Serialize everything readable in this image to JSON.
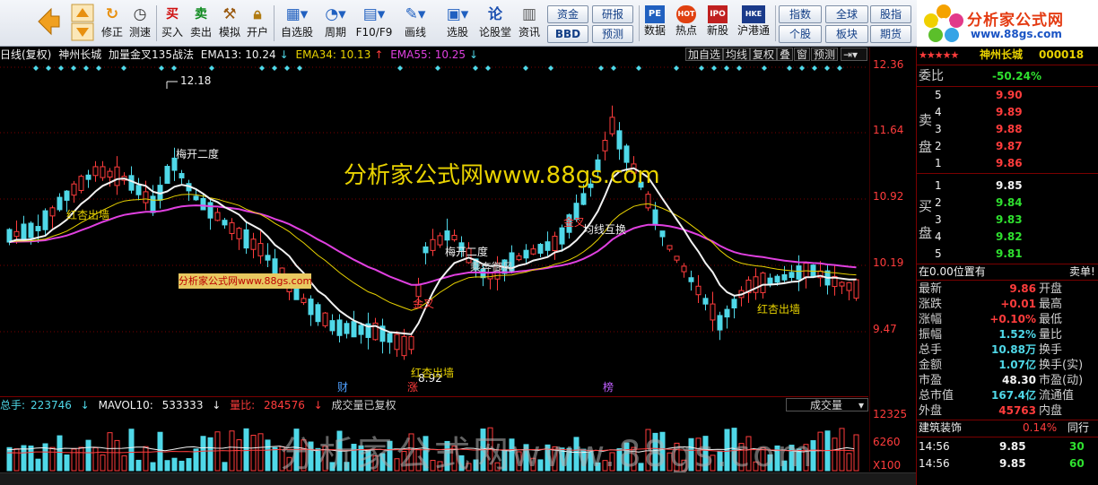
{
  "toolbar": {
    "buttons": [
      {
        "label": "修正"
      },
      {
        "label": "测速"
      },
      {
        "label": "买入"
      },
      {
        "label": "卖出"
      },
      {
        "label": "模拟"
      },
      {
        "label": "开户"
      },
      {
        "label": "自选股"
      },
      {
        "label": "周期"
      },
      {
        "label": "F10/F9"
      },
      {
        "label": "画线"
      },
      {
        "label": "选股"
      },
      {
        "label": "论股堂"
      },
      {
        "label": "资讯"
      },
      {
        "label": "数据"
      },
      {
        "label": "热点"
      },
      {
        "label": "新股"
      },
      {
        "label": "沪港通"
      }
    ],
    "icon_buy": "买",
    "icon_sell": "卖",
    "icon_lun": "论",
    "icon_pe": "PE",
    "icon_hot": "HOT",
    "icon_ipo": "IPO",
    "icon_hk": "HKE",
    "box_buttons": [
      "资金",
      "研报",
      "BBD",
      "预测",
      "指数",
      "全球",
      "股指",
      "个股",
      "板块",
      "期货"
    ]
  },
  "logo": {
    "name": "分析家公式网",
    "url": "www.88gs.com"
  },
  "chart_header": {
    "period": "日线(复权)",
    "stock_name": "神州长城",
    "indicator_name": "加量金叉135战法",
    "ema13_label": "EMA13:",
    "ema13": "10.24",
    "ema34_label": "EMA34:",
    "ema34": "10.13",
    "ema55_label": "EMA55:",
    "ema55": "10.25",
    "buttons": [
      "加自选",
      "均线",
      "复权",
      "叠",
      "窗",
      "预测"
    ]
  },
  "watermark_main": "分析家公式网www.88gs.com",
  "promo_box": "分析家公式网www.88gs.com",
  "annotations": {
    "high_value": "12.18",
    "low_value": "8.92",
    "labels": [
      {
        "text": "红杏出墙",
        "color": "#e8d200"
      },
      {
        "text": "梅开二度",
        "color": "#f2f2f2"
      },
      {
        "text": "红杏出墙",
        "color": "#e8d200"
      },
      {
        "text": "金叉",
        "color": "#ff3c3c"
      },
      {
        "text": "梅开二度",
        "color": "#f2f2f2"
      },
      {
        "text": "乘奔御风",
        "color": "#cfcfcf"
      },
      {
        "text": "金叉",
        "color": "#ff3c3c"
      },
      {
        "text": "均线互换",
        "color": "#f2f2f2"
      },
      {
        "text": "红杏出墙",
        "color": "#e8d200"
      }
    ],
    "markers": [
      {
        "text": "财",
        "color": "#4fa0ff"
      },
      {
        "text": "涨",
        "color": "#ff3c3c"
      },
      {
        "text": "榜",
        "color": "#c060ff"
      }
    ]
  },
  "volume_header": {
    "total_label": "总手:",
    "total": "223746",
    "mavol_label": "MAVOL10:",
    "mavol": "533333",
    "ratio_label": "量比:",
    "ratio": "284576",
    "note": "成交量已复权",
    "selector": "成交量"
  },
  "watermark_bottom": "分析家公式网www.88gs.com",
  "price_ticks": [
    "12.36",
    "11.64",
    "10.92",
    "10.19",
    "9.47"
  ],
  "volume_ticks": [
    "12325",
    "6260",
    "X100"
  ],
  "right_panel": {
    "stock_name": "神州长城",
    "stock_code": "000018",
    "wei_label": "委比",
    "wei_value": "-50.24%",
    "sell_label": "卖盘",
    "buy_label": "买盘",
    "sell_levels": [
      {
        "level": "5",
        "price": "9.90"
      },
      {
        "level": "4",
        "price": "9.89"
      },
      {
        "level": "3",
        "price": "9.88"
      },
      {
        "level": "2",
        "price": "9.87"
      },
      {
        "level": "1",
        "price": "9.86"
      }
    ],
    "buy_levels": [
      {
        "level": "1",
        "price": "9.85"
      },
      {
        "level": "2",
        "price": "9.84"
      },
      {
        "level": "3",
        "price": "9.83"
      },
      {
        "level": "4",
        "price": "9.82"
      },
      {
        "level": "5",
        "price": "9.81"
      }
    ],
    "position_note": "在0.00位置有",
    "sell_tag": "卖单!",
    "stats": [
      {
        "k1": "最新",
        "v1": "9.86",
        "c1": "#ff3c3c",
        "k2": "开盘",
        "v2": ""
      },
      {
        "k1": "涨跌",
        "v1": "+0.01",
        "c1": "#ff3c3c",
        "k2": "最高",
        "v2": ""
      },
      {
        "k1": "涨幅",
        "v1": "+0.10%",
        "c1": "#ff3c3c",
        "k2": "最低",
        "v2": ""
      },
      {
        "k1": "振幅",
        "v1": "1.52%",
        "c1": "#4fd8e8",
        "k2": "量比",
        "v2": ""
      },
      {
        "k1": "总手",
        "v1": "10.88万",
        "c1": "#4fd8e8",
        "k2": "换手",
        "v2": ""
      },
      {
        "k1": "金额",
        "v1": "1.07亿",
        "c1": "#4fd8e8",
        "k2": "换手(实)",
        "v2": ""
      },
      {
        "k1": "市盈",
        "v1": "48.30",
        "c1": "#f2f2f2",
        "k2": "市盈(动)",
        "v2": ""
      },
      {
        "k1": "总市值",
        "v1": "167.4亿",
        "c1": "#4fd8e8",
        "k2": "流通值",
        "v2": ""
      },
      {
        "k1": "外盘",
        "v1": "45763",
        "c1": "#ff3c3c",
        "k2": "内盘",
        "v2": ""
      }
    ],
    "industry": "建筑装饰",
    "industry_change": "0.14%",
    "industry_tab": "同行",
    "ticks": [
      {
        "time": "14:56",
        "price": "9.85",
        "vol": "30"
      },
      {
        "time": "14:56",
        "price": "9.85",
        "vol": "60"
      }
    ]
  },
  "colors": {
    "up": "#ff3c3c",
    "down": "#4fd8e8",
    "ema13": "#f2f2f2",
    "ema34": "#e8d200",
    "ema55": "#e040e0",
    "grid": "#7a0000"
  }
}
